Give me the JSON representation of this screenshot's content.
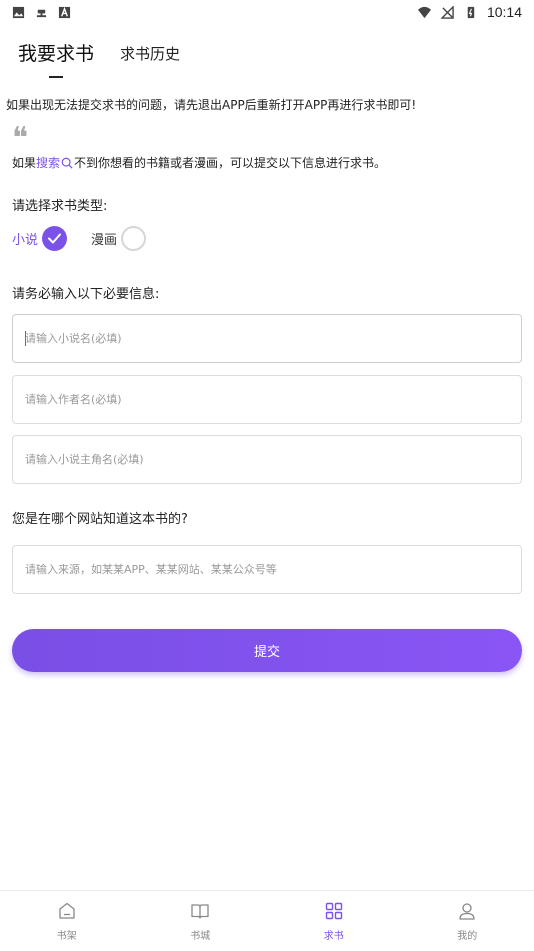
{
  "status_bar": {
    "time": "10:14",
    "left_icons": [
      "image-icon",
      "bug-icon",
      "text-icon"
    ],
    "right_icons": [
      "wifi-icon",
      "no-signal-icon",
      "battery-icon"
    ]
  },
  "top_tabs": [
    {
      "label": "我要求书",
      "active": true
    },
    {
      "label": "求书历史",
      "active": false
    }
  ],
  "notice": "如果出现无法提交求书的问题，请先退出APP后重新打开APP再进行求书即可!",
  "intro": {
    "prefix": "如果",
    "link": "搜索",
    "suffix": "不到你想看的书籍或者漫画，可以提交以下信息进行求书。"
  },
  "type_section": {
    "label": "请选择求书类型:",
    "options": [
      {
        "label": "小说",
        "selected": true
      },
      {
        "label": "漫画",
        "selected": false
      }
    ]
  },
  "required_section": {
    "label": "请务必输入以下必要信息:",
    "fields": [
      {
        "placeholder": "请输入小说名(必填)",
        "value": ""
      },
      {
        "placeholder": "请输入作者名(必填)",
        "value": ""
      },
      {
        "placeholder": "请输入小说主角名(必填)",
        "value": ""
      }
    ]
  },
  "source_section": {
    "label": "您是在哪个网站知道这本书的?",
    "field": {
      "placeholder": "请输入来源，如某某APP、某某网站、某某公众号等",
      "value": ""
    }
  },
  "submit_label": "提交",
  "bottom_nav": [
    {
      "label": "书架",
      "icon": "home-icon",
      "active": false
    },
    {
      "label": "书城",
      "icon": "book-icon",
      "active": false
    },
    {
      "label": "求书",
      "icon": "grid-icon",
      "active": true
    },
    {
      "label": "我的",
      "icon": "user-icon",
      "active": false
    }
  ],
  "colors": {
    "accent": "#7b52e8",
    "inactive": "#888888"
  }
}
